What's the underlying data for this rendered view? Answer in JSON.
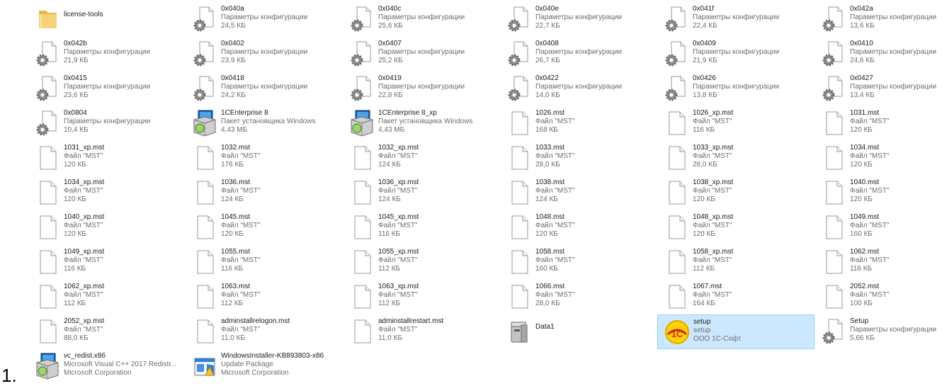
{
  "list_marker": "1.",
  "items": [
    {
      "name": "license-tools",
      "type": "",
      "size": "",
      "icon": "folder-icon"
    },
    {
      "name": "0x040a",
      "type": "Параметры конфигурации",
      "size": "24,5 КБ",
      "icon": "config-file-icon"
    },
    {
      "name": "0x040c",
      "type": "Параметры конфигурации",
      "size": "25,6 КБ",
      "icon": "config-file-icon"
    },
    {
      "name": "0x040e",
      "type": "Параметры конфигурации",
      "size": "22,7 КБ",
      "icon": "config-file-icon"
    },
    {
      "name": "0x041f",
      "type": "Параметры конфигурации",
      "size": "22,4 КБ",
      "icon": "config-file-icon"
    },
    {
      "name": "0x042a",
      "type": "Параметры конфигурации",
      "size": "13,6 КБ",
      "icon": "config-file-icon"
    },
    {
      "name": "0x042b",
      "type": "Параметры конфигурации",
      "size": "21,9 КБ",
      "icon": "config-file-icon"
    },
    {
      "name": "0x0402",
      "type": "Параметры конфигурации",
      "size": "23,9 КБ",
      "icon": "config-file-icon"
    },
    {
      "name": "0x0407",
      "type": "Параметры конфигурации",
      "size": "25,2 КБ",
      "icon": "config-file-icon"
    },
    {
      "name": "0x0408",
      "type": "Параметры конфигурации",
      "size": "26,7 КБ",
      "icon": "config-file-icon"
    },
    {
      "name": "0x0409",
      "type": "Параметры конфигурации",
      "size": "21,9 КБ",
      "icon": "config-file-icon"
    },
    {
      "name": "0x0410",
      "type": "Параметры конфигурации",
      "size": "24,6 КБ",
      "icon": "config-file-icon"
    },
    {
      "name": "0x0415",
      "type": "Параметры конфигурации",
      "size": "23,6 КБ",
      "icon": "config-file-icon"
    },
    {
      "name": "0x0418",
      "type": "Параметры конфигурации",
      "size": "24,2 КБ",
      "icon": "config-file-icon"
    },
    {
      "name": "0x0419",
      "type": "Параметры конфигурации",
      "size": "22,8 КБ",
      "icon": "config-file-icon"
    },
    {
      "name": "0x0422",
      "type": "Параметры конфигурации",
      "size": "14,0 КБ",
      "icon": "config-file-icon"
    },
    {
      "name": "0x0426",
      "type": "Параметры конфигурации",
      "size": "13,8 КБ",
      "icon": "config-file-icon"
    },
    {
      "name": "0x0427",
      "type": "Параметры конфигурации",
      "size": "13,4 КБ",
      "icon": "config-file-icon"
    },
    {
      "name": "0x0804",
      "type": "Параметры конфигурации",
      "size": "10,4 КБ",
      "icon": "config-file-icon"
    },
    {
      "name": "1CEnterprise 8",
      "type": "Пакет установщика Windows",
      "size": "4,43 МБ",
      "icon": "installer-package-icon"
    },
    {
      "name": "1CEnterprise 8_xp",
      "type": "Пакет установщика Windows",
      "size": "4,43 МБ",
      "icon": "installer-package-icon"
    },
    {
      "name": "1026.mst",
      "type": "Файл \"MST\"",
      "size": "168 КБ",
      "icon": "blank-file-icon"
    },
    {
      "name": "1026_xp.mst",
      "type": "Файл \"MST\"",
      "size": "116 КБ",
      "icon": "blank-file-icon"
    },
    {
      "name": "1031.mst",
      "type": "Файл \"MST\"",
      "size": "120 КБ",
      "icon": "blank-file-icon"
    },
    {
      "name": "1031_xp.mst",
      "type": "Файл \"MST\"",
      "size": "120 КБ",
      "icon": "blank-file-icon"
    },
    {
      "name": "1032.mst",
      "type": "Файл \"MST\"",
      "size": "176 КБ",
      "icon": "blank-file-icon"
    },
    {
      "name": "1032_xp.mst",
      "type": "Файл \"MST\"",
      "size": "124 КБ",
      "icon": "blank-file-icon"
    },
    {
      "name": "1033.mst",
      "type": "Файл \"MST\"",
      "size": "28,0 КБ",
      "icon": "blank-file-icon"
    },
    {
      "name": "1033_xp.mst",
      "type": "Файл \"MST\"",
      "size": "28,0 КБ",
      "icon": "blank-file-icon"
    },
    {
      "name": "1034.mst",
      "type": "Файл \"MST\"",
      "size": "120 КБ",
      "icon": "blank-file-icon"
    },
    {
      "name": "1034_xp.mst",
      "type": "Файл \"MST\"",
      "size": "120 КБ",
      "icon": "blank-file-icon"
    },
    {
      "name": "1036.mst",
      "type": "Файл \"MST\"",
      "size": "124 КБ",
      "icon": "blank-file-icon"
    },
    {
      "name": "1036_xp.mst",
      "type": "Файл \"MST\"",
      "size": "124 КБ",
      "icon": "blank-file-icon"
    },
    {
      "name": "1038.mst",
      "type": "Файл \"MST\"",
      "size": "124 КБ",
      "icon": "blank-file-icon"
    },
    {
      "name": "1038_xp.mst",
      "type": "Файл \"MST\"",
      "size": "120 КБ",
      "icon": "blank-file-icon"
    },
    {
      "name": "1040.mst",
      "type": "Файл \"MST\"",
      "size": "120 КБ",
      "icon": "blank-file-icon"
    },
    {
      "name": "1040_xp.mst",
      "type": "Файл \"MST\"",
      "size": "120 КБ",
      "icon": "blank-file-icon"
    },
    {
      "name": "1045.mst",
      "type": "Файл \"MST\"",
      "size": "120 КБ",
      "icon": "blank-file-icon"
    },
    {
      "name": "1045_xp.mst",
      "type": "Файл \"MST\"",
      "size": "116 КБ",
      "icon": "blank-file-icon"
    },
    {
      "name": "1048.mst",
      "type": "Файл \"MST\"",
      "size": "120 КБ",
      "icon": "blank-file-icon"
    },
    {
      "name": "1048_xp.mst",
      "type": "Файл \"MST\"",
      "size": "120 КБ",
      "icon": "blank-file-icon"
    },
    {
      "name": "1049.mst",
      "type": "Файл \"MST\"",
      "size": "160 КБ",
      "icon": "blank-file-icon"
    },
    {
      "name": "1049_xp.mst",
      "type": "Файл \"MST\"",
      "size": "116 КБ",
      "icon": "blank-file-icon"
    },
    {
      "name": "1055.mst",
      "type": "Файл \"MST\"",
      "size": "116 КБ",
      "icon": "blank-file-icon"
    },
    {
      "name": "1055_xp.mst",
      "type": "Файл \"MST\"",
      "size": "112 КБ",
      "icon": "blank-file-icon"
    },
    {
      "name": "1058.mst",
      "type": "Файл \"MST\"",
      "size": "160 КБ",
      "icon": "blank-file-icon"
    },
    {
      "name": "1058_xp.mst",
      "type": "Файл \"MST\"",
      "size": "112 КБ",
      "icon": "blank-file-icon"
    },
    {
      "name": "1062.mst",
      "type": "Файл \"MST\"",
      "size": "116 КБ",
      "icon": "blank-file-icon"
    },
    {
      "name": "1062_xp.mst",
      "type": "Файл \"MST\"",
      "size": "112 КБ",
      "icon": "blank-file-icon"
    },
    {
      "name": "1063.mst",
      "type": "Файл \"MST\"",
      "size": "112 КБ",
      "icon": "blank-file-icon"
    },
    {
      "name": "1063_xp.mst",
      "type": "Файл \"MST\"",
      "size": "112 КБ",
      "icon": "blank-file-icon"
    },
    {
      "name": "1066.mst",
      "type": "Файл \"MST\"",
      "size": "28,0 КБ",
      "icon": "blank-file-icon"
    },
    {
      "name": "1067.mst",
      "type": "Файл \"MST\"",
      "size": "164 КБ",
      "icon": "blank-file-icon"
    },
    {
      "name": "2052.mst",
      "type": "Файл \"MST\"",
      "size": "100 КБ",
      "icon": "blank-file-icon"
    },
    {
      "name": "2052_xp.mst",
      "type": "Файл \"MST\"",
      "size": "88,0 КБ",
      "icon": "blank-file-icon"
    },
    {
      "name": "adminstallrelogon.mst",
      "type": "Файл \"MST\"",
      "size": "11,0 КБ",
      "icon": "blank-file-icon"
    },
    {
      "name": "adminstallrestart.mst",
      "type": "Файл \"MST\"",
      "size": "11,0 КБ",
      "icon": "blank-file-icon"
    },
    {
      "name": "Data1",
      "type": "",
      "size": "",
      "icon": "cabinet-archive-icon"
    },
    {
      "name": "setup",
      "type": "setup",
      "size": "ООО 1С-Софт",
      "icon": "1c-setup-icon",
      "selected": true
    },
    {
      "name": "Setup",
      "type": "Параметры конфигурации",
      "size": "5,66 КБ",
      "icon": "config-file-icon"
    },
    {
      "name": "vc_redist.x86",
      "type": "Microsoft Visual C++ 2017 Redistr...",
      "size": "Microsoft Corporation",
      "icon": "installer-package-icon"
    },
    {
      "name": "WindowsInstaller-KB893803-x86",
      "type": "Update Package",
      "size": "Microsoft Corporation",
      "icon": "update-package-icon"
    }
  ]
}
